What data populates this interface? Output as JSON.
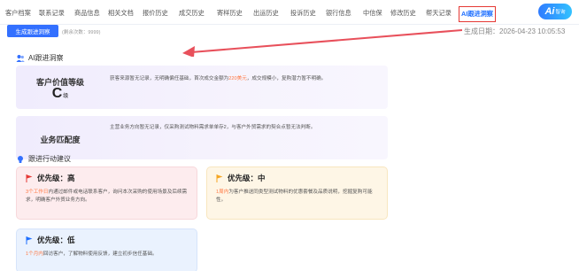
{
  "tabs": [
    {
      "label": "客户档案"
    },
    {
      "label": "联系记录"
    },
    {
      "label": "商品信息"
    },
    {
      "label": "相关文档"
    },
    {
      "label": "报价历史"
    },
    {
      "label": "成交历史"
    },
    {
      "label": "寄样历史"
    },
    {
      "label": "出运历史"
    },
    {
      "label": "投诉历史"
    },
    {
      "label": "银行信息"
    },
    {
      "label": "中信保"
    },
    {
      "label": "修改历史"
    },
    {
      "label": "帮天记录"
    },
    {
      "label": "AI跟进洞察"
    }
  ],
  "ai_badge": {
    "big": "Ai",
    "small": "智询"
  },
  "toolbar": {
    "generate_label": "生成跟进洞察",
    "remaining": "(剩余次数：9999)",
    "gen_date_label": "生成日期：",
    "gen_date_value": "2026-04-23 10:05:53"
  },
  "insight": {
    "section_title": "AI跟进洞察",
    "value_card": {
      "label": "客户价值等级",
      "grade": "C",
      "grade_unit": "级",
      "desc_before": "获客来源暂无记录，无明确偏任基础，首次成交金额为",
      "desc_highlight": "220美元",
      "desc_after": "，成交规模小，复购潜力暂不明确。"
    },
    "match_card": {
      "label": "业务匹配度",
      "desc": "主营业务方向暂无记录，仅采购测试物料需求单单存2，与客户外贸需求的契合点暂无法判断。"
    }
  },
  "actions": {
    "section_title": "跟进行动建议",
    "high": {
      "title": "优先级：高",
      "highlight": "3个工作日",
      "desc": "内通过邮件或电话联系客户，询问本次采购的使用场景及后续需求，明确客户外贸业务方向。"
    },
    "mid": {
      "title": "优先级：中",
      "highlight": "1周内",
      "desc": "为客户推送同类型测试物料的优惠套餐及品质说明，挖掘复购可能性。"
    },
    "low": {
      "title": "优先级：低",
      "highlight": "1个月内",
      "desc": "回访客户，了解物料使用反馈，建立初步信任基础。"
    }
  },
  "colors": {
    "accent": "#3370ff",
    "highlight": "#ff7a45",
    "flag_red": "#e53935",
    "flag_orange": "#f5a623",
    "flag_blue": "#1e6fff"
  }
}
